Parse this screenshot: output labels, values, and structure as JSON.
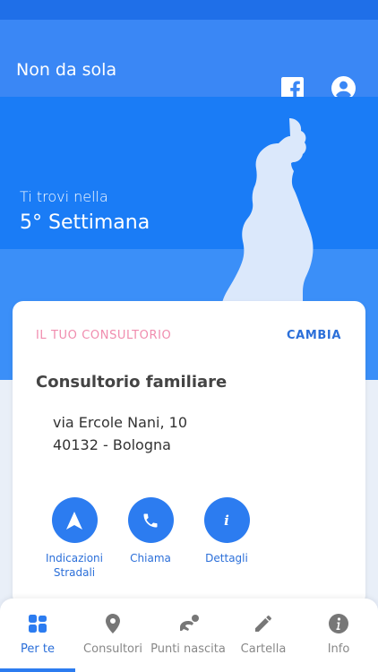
{
  "app": {
    "title": "Non da sola"
  },
  "header_icons": [
    "facebook-icon",
    "profile-icon"
  ],
  "hero": {
    "subtitle": "Ti trovi nella",
    "week": "5° Settimana"
  },
  "consultorio": {
    "section_label": "IL TUO CONSULTORIO",
    "change_label": "CAMBIA",
    "name": "Consultorio familiare",
    "address_line1": "via Ercole Nani, 10",
    "address_line2": "40132 - Bologna"
  },
  "actions": [
    {
      "label_line1": "Indicazioni",
      "label_line2": "Stradali",
      "icon": "navigation-arrow-icon"
    },
    {
      "label_line1": "Chiama",
      "icon": "phone-icon"
    },
    {
      "label_line1": "Dettagli",
      "icon": "info-icon"
    }
  ],
  "bottom_nav": [
    {
      "label": "Per te",
      "icon": "dashboard-icon",
      "active": true
    },
    {
      "label": "Consultori",
      "icon": "location-pin-icon",
      "active": false
    },
    {
      "label": "Punti nascita",
      "icon": "baby-crawl-icon",
      "active": false
    },
    {
      "label": "Cartella",
      "icon": "pencil-icon",
      "active": false
    },
    {
      "label": "Info",
      "icon": "info-icon",
      "active": false
    }
  ],
  "colors": {
    "primary": "#2c7cf0",
    "header": "#3a87f5",
    "accent_pink": "#f08cae"
  }
}
